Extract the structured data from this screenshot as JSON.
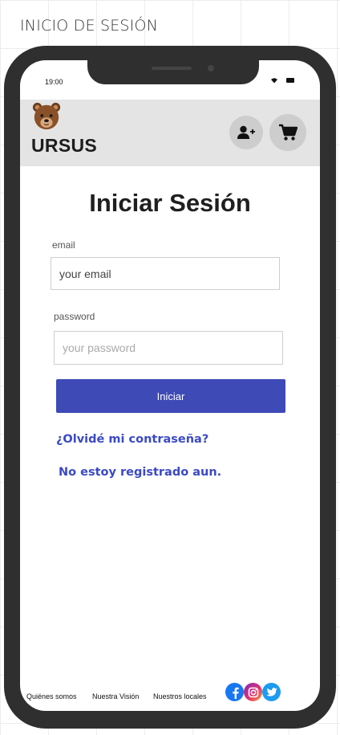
{
  "frame_title": "INICIO DE SESIÓN",
  "status_bar": {
    "time": "19:00"
  },
  "header": {
    "brand": "URSUS",
    "logo_icon": "bear-logo-icon",
    "add_user_icon": "user-plus-icon",
    "cart_icon": "shopping-cart-icon",
    "background": "#e4e4e4"
  },
  "login": {
    "title": "Iniciar Sesión",
    "email_label": "email",
    "email_placeholder": "your email",
    "password_label": "password",
    "password_placeholder": "your password",
    "submit_label": "Iniciar",
    "forgot_link": "¿Olvidé mi contraseña?",
    "register_link": "No estoy registrado aun."
  },
  "footer": {
    "links": [
      "Quiénes somos",
      "Nuestra Visión",
      "Nuestros locales"
    ],
    "social": [
      "facebook-icon",
      "instagram-icon",
      "twitter-icon"
    ]
  },
  "colors": {
    "primary": "#3e4ab5",
    "link": "#3b4ac4",
    "phone_frame": "#2f2f2f"
  }
}
